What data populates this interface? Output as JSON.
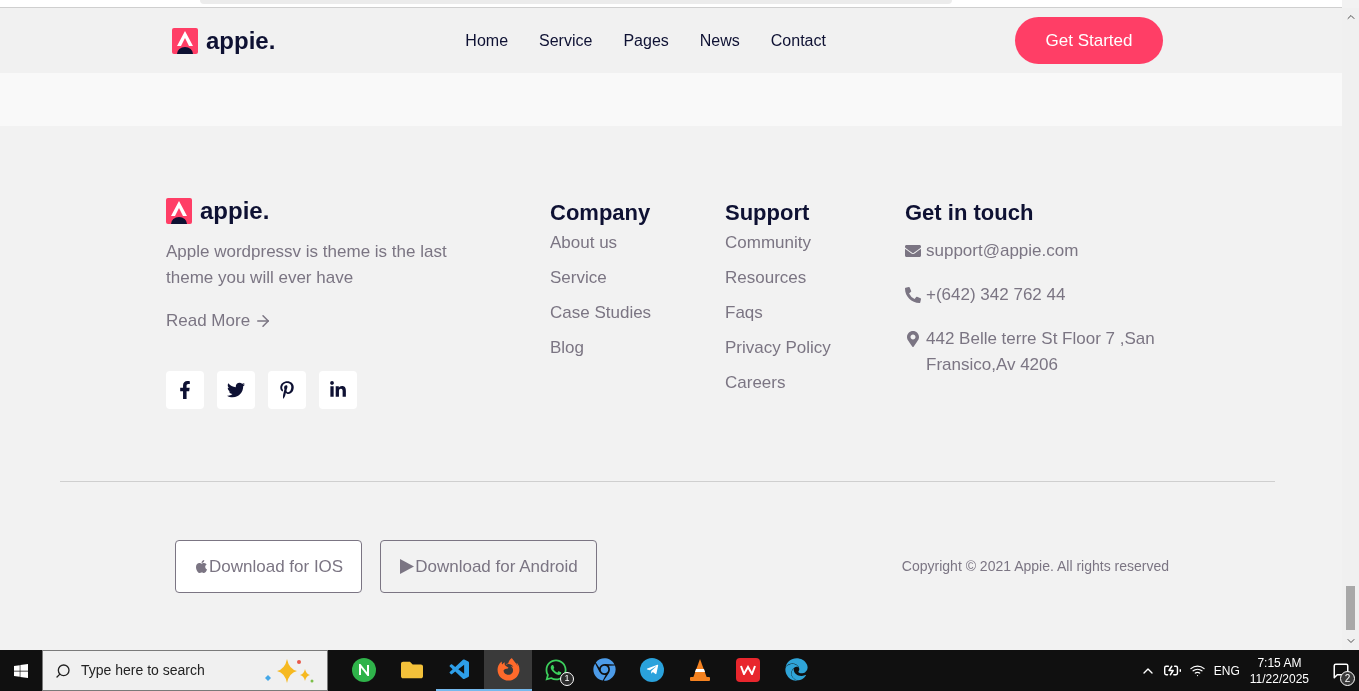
{
  "header": {
    "brand": "appie.",
    "nav": [
      "Home",
      "Service",
      "Pages",
      "News",
      "Contact"
    ],
    "cta": "Get Started"
  },
  "footer": {
    "brand": "appie.",
    "about": "Apple wordpressv is theme is the last theme you will ever have",
    "read_more": "Read More",
    "socials": [
      {
        "kind": "facebook"
      },
      {
        "kind": "twitter"
      },
      {
        "kind": "pinterest"
      },
      {
        "kind": "linkedin"
      }
    ],
    "columns": [
      {
        "title": "Company",
        "links": [
          "About us",
          "Service",
          "Case Studies",
          "Blog"
        ]
      },
      {
        "title": "Support",
        "links": [
          "Community",
          "Resources",
          "Faqs",
          "Privacy Policy",
          "Careers"
        ]
      }
    ],
    "contact": {
      "title": "Get in touch",
      "items": [
        {
          "kind": "email",
          "text": "support@appie.com"
        },
        {
          "kind": "phone",
          "text": "+(642) 342 762 44"
        },
        {
          "kind": "location",
          "text": "442 Belle terre St Floor 7 ,San Fransico,Av 4206"
        }
      ]
    },
    "downloads": [
      {
        "kind": "ios",
        "label": "Download for IOS",
        "selected": true
      },
      {
        "kind": "android",
        "label": "Download for Android",
        "selected": false
      }
    ],
    "copyright": "Copyright © 2021 Appie. All rights reserved"
  },
  "taskbar": {
    "search_placeholder": "Type here to search",
    "apps": [
      {
        "kind": "notes",
        "running": false,
        "selected": false
      },
      {
        "kind": "folder",
        "running": false,
        "selected": false
      },
      {
        "kind": "code",
        "running": true,
        "selected": false
      },
      {
        "kind": "browser",
        "running": true,
        "selected": true
      },
      {
        "kind": "chat",
        "running": false,
        "selected": false,
        "badge": "1"
      },
      {
        "kind": "chrome",
        "running": false,
        "selected": false
      },
      {
        "kind": "telegram",
        "running": false,
        "selected": false
      },
      {
        "kind": "cone",
        "running": false,
        "selected": false
      },
      {
        "kind": "office",
        "running": false,
        "selected": false
      },
      {
        "kind": "edge",
        "running": false,
        "selected": false
      }
    ],
    "language": "ENG",
    "time": "7:15 AM",
    "date": "11/22/2025",
    "notifications": "2"
  }
}
